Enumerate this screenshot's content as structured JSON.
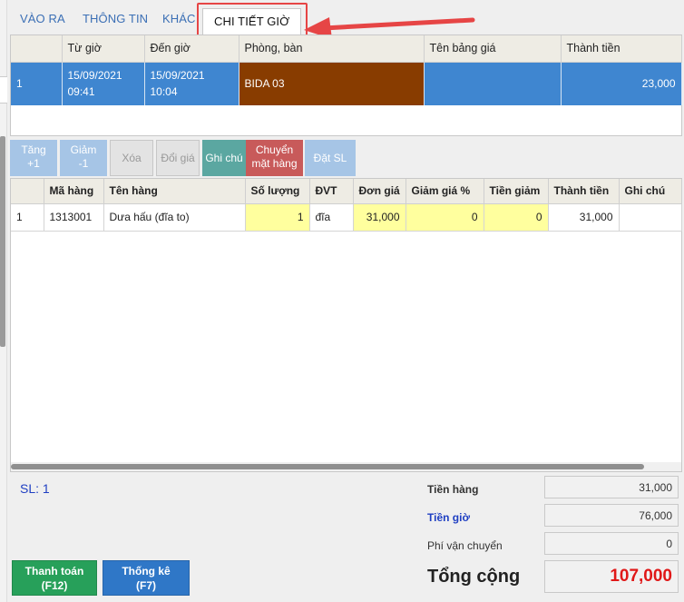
{
  "tabs": [
    {
      "label": "VÀO RA"
    },
    {
      "label": "THÔNG TIN"
    },
    {
      "label": "KHÁC"
    },
    {
      "label": "CHI TIẾT GIỜ"
    }
  ],
  "time_table": {
    "headers": [
      "",
      "Từ giờ",
      "Đến giờ",
      "Phòng, bàn",
      "Tên bảng giá",
      "Thành tiền"
    ],
    "row": {
      "index": "1",
      "from_date": "15/09/2021",
      "from_time": "09:41",
      "to_date": "15/09/2021",
      "to_time": "10:04",
      "room": "BIDA 03",
      "price_list": "",
      "amount": "23,000"
    }
  },
  "toolbar": {
    "increase_line1": "Tăng",
    "increase_line2": "+1",
    "decrease_line1": "Giảm",
    "decrease_line2": "-1",
    "delete": "Xóa",
    "change_price": "Đổi giá",
    "note": "Ghi chú",
    "move_line1": "Chuyển",
    "move_line2": "mặt hàng",
    "set_qty": "Đặt SL"
  },
  "items_table": {
    "headers": [
      "",
      "Mã hàng",
      "Tên hàng",
      "Số lượng",
      "ĐVT",
      "Đơn giá",
      "Giảm giá %",
      "Tiền giảm",
      "Thành tiền",
      "Ghi chú"
    ],
    "rows": [
      {
        "index": "1",
        "code": "1313001",
        "name": "Dưa hấu (đĩa to)",
        "qty": "1",
        "unit": "đĩa",
        "price": "31,000",
        "discount_pct": "0",
        "discount_amt": "0",
        "total": "31,000",
        "note": ""
      }
    ]
  },
  "footer": {
    "sl": "SL: 1",
    "goods_label": "Tiền hàng",
    "goods_value": "31,000",
    "time_label": "Tiền giờ",
    "time_value": "76,000",
    "shipping_label": "Phí vận chuyển",
    "shipping_value": "0",
    "total_label": "Tổng cộng",
    "total_value": "107,000",
    "pay_line1": "Thanh toán",
    "pay_line2": "(F12)",
    "stats_line1": "Thống kê",
    "stats_line2": "(F7)"
  },
  "colors": {
    "accent": "#3f86d0",
    "room_cell": "#883c00",
    "editable_cell": "#ffff9e",
    "total": "#e01818",
    "pay_button": "#27a05a",
    "stats_button": "#2f77c7",
    "callout": "#e64545"
  }
}
